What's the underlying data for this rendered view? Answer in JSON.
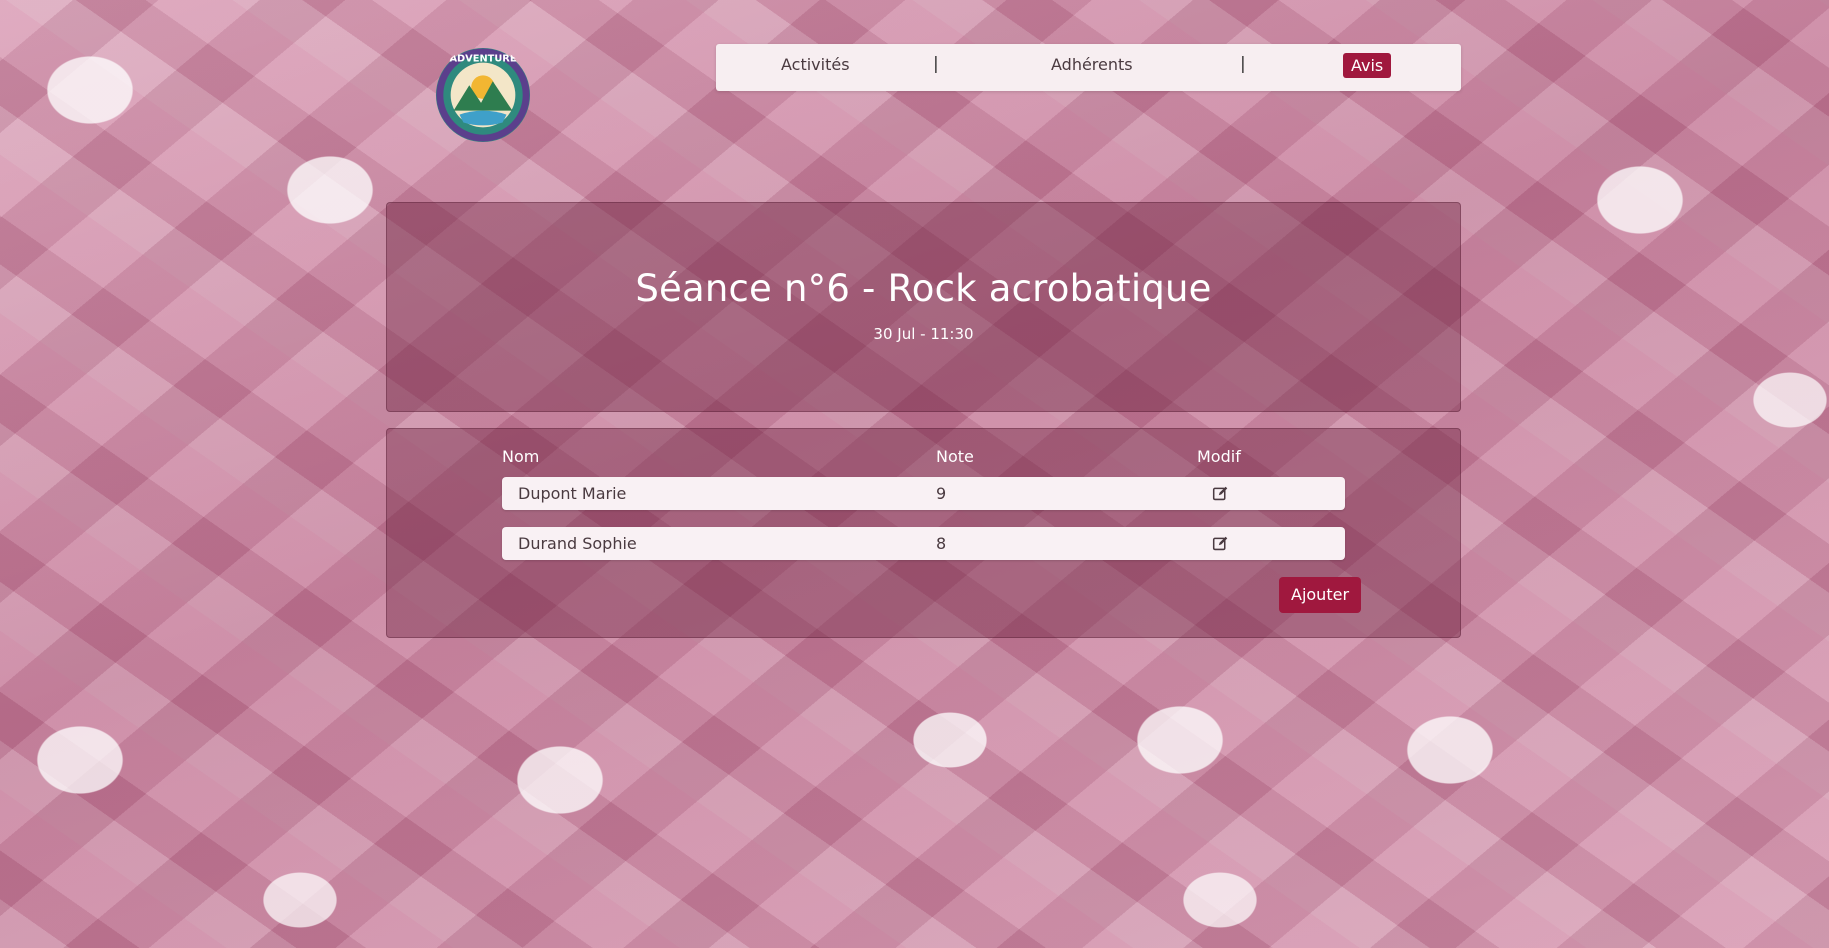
{
  "brand": {
    "logo_icon": "adventure-badge-logo",
    "logo_text": "ADVENTURE"
  },
  "nav": {
    "items": [
      {
        "label": "Activités"
      },
      {
        "label": "Adhérents"
      },
      {
        "label": "Avis",
        "active": true
      }
    ],
    "separator": "|",
    "active_color": "#a0183e"
  },
  "session": {
    "title": "Séance n°6 - Rock acrobatique",
    "datetime": "30 Jul - 11:30"
  },
  "table": {
    "headers": [
      "Nom",
      "Note",
      "Modif"
    ],
    "rows": [
      {
        "name": "Dupont Marie",
        "note": "9",
        "edit_icon": "edit-icon"
      },
      {
        "name": "Durand Sophie",
        "note": "8",
        "edit_icon": "edit-icon"
      }
    ]
  },
  "actions": {
    "add_label": "Ajouter"
  }
}
